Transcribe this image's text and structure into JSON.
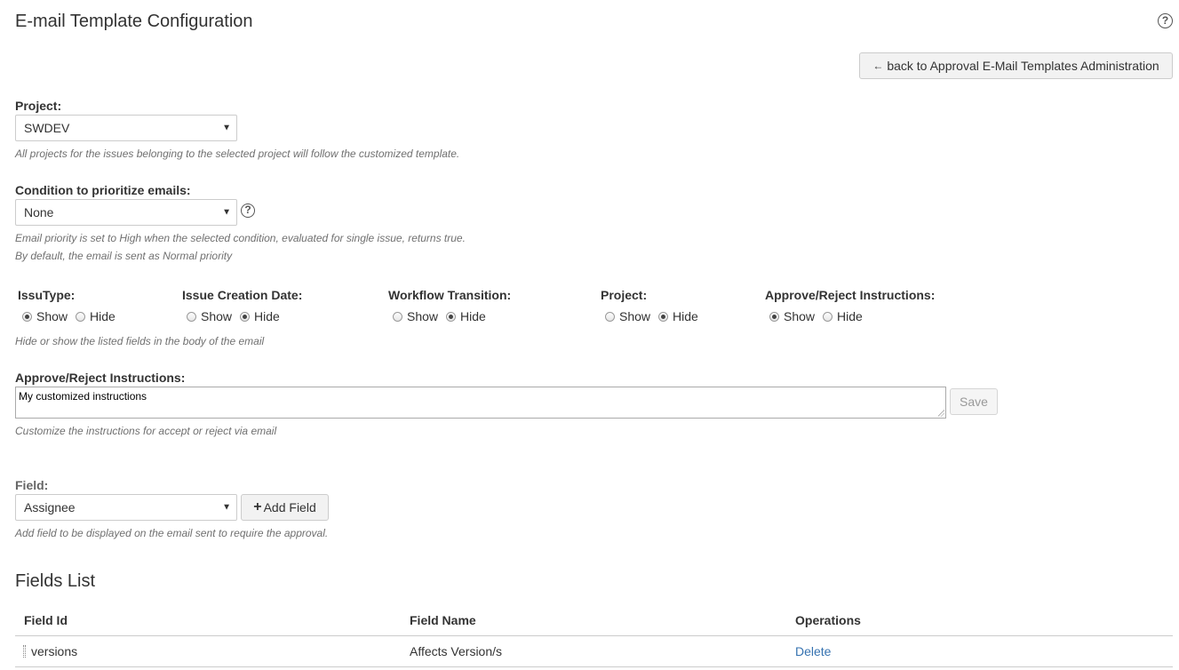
{
  "page": {
    "title": "E-mail Template Configuration",
    "help_icon_glyph": "?",
    "back_button_label": "back to Approval E-Mail Templates Administration",
    "back_icon_glyph": "←"
  },
  "project": {
    "label": "Project:",
    "selected": "SWDEV",
    "description": "All projects for the issues belonging to the selected project will follow the customized template."
  },
  "condition": {
    "label": "Condition to prioritize emails:",
    "selected": "None",
    "help_glyph": "?",
    "description_line1": "Email priority is set to High when the selected condition, evaluated for single issue, returns true.",
    "description_line2": "By default, the email is sent as Normal priority"
  },
  "visibility": {
    "show_label": "Show",
    "hide_label": "Hide",
    "fields": [
      {
        "label": "IssuType:",
        "value": "Show"
      },
      {
        "label": "Issue Creation Date:",
        "value": "Hide"
      },
      {
        "label": "Workflow Transition:",
        "value": "Hide"
      },
      {
        "label": "Project:",
        "value": "Hide"
      },
      {
        "label": "Approve/Reject Instructions:",
        "value": "Show"
      }
    ],
    "description": "Hide or show the listed fields in the body of the email"
  },
  "instructions": {
    "label": "Approve/Reject Instructions:",
    "value": "My customized instructions",
    "save_label": "Save",
    "description": "Customize the instructions for accept or reject via email"
  },
  "field_picker": {
    "label": "Field:",
    "selected": "Assignee",
    "add_label": "Add Field",
    "add_icon_glyph": "+",
    "description": "Add field to be displayed on the email sent to require the approval."
  },
  "fields_list": {
    "title": "Fields List",
    "headers": [
      "Field Id",
      "Field Name",
      "Operations"
    ],
    "rows": [
      {
        "id": "versions",
        "name": "Affects Version/s",
        "operation": "Delete"
      }
    ]
  },
  "colors": {
    "link": "#3572b0",
    "border": "#cccccc",
    "muted_text": "#707070"
  }
}
